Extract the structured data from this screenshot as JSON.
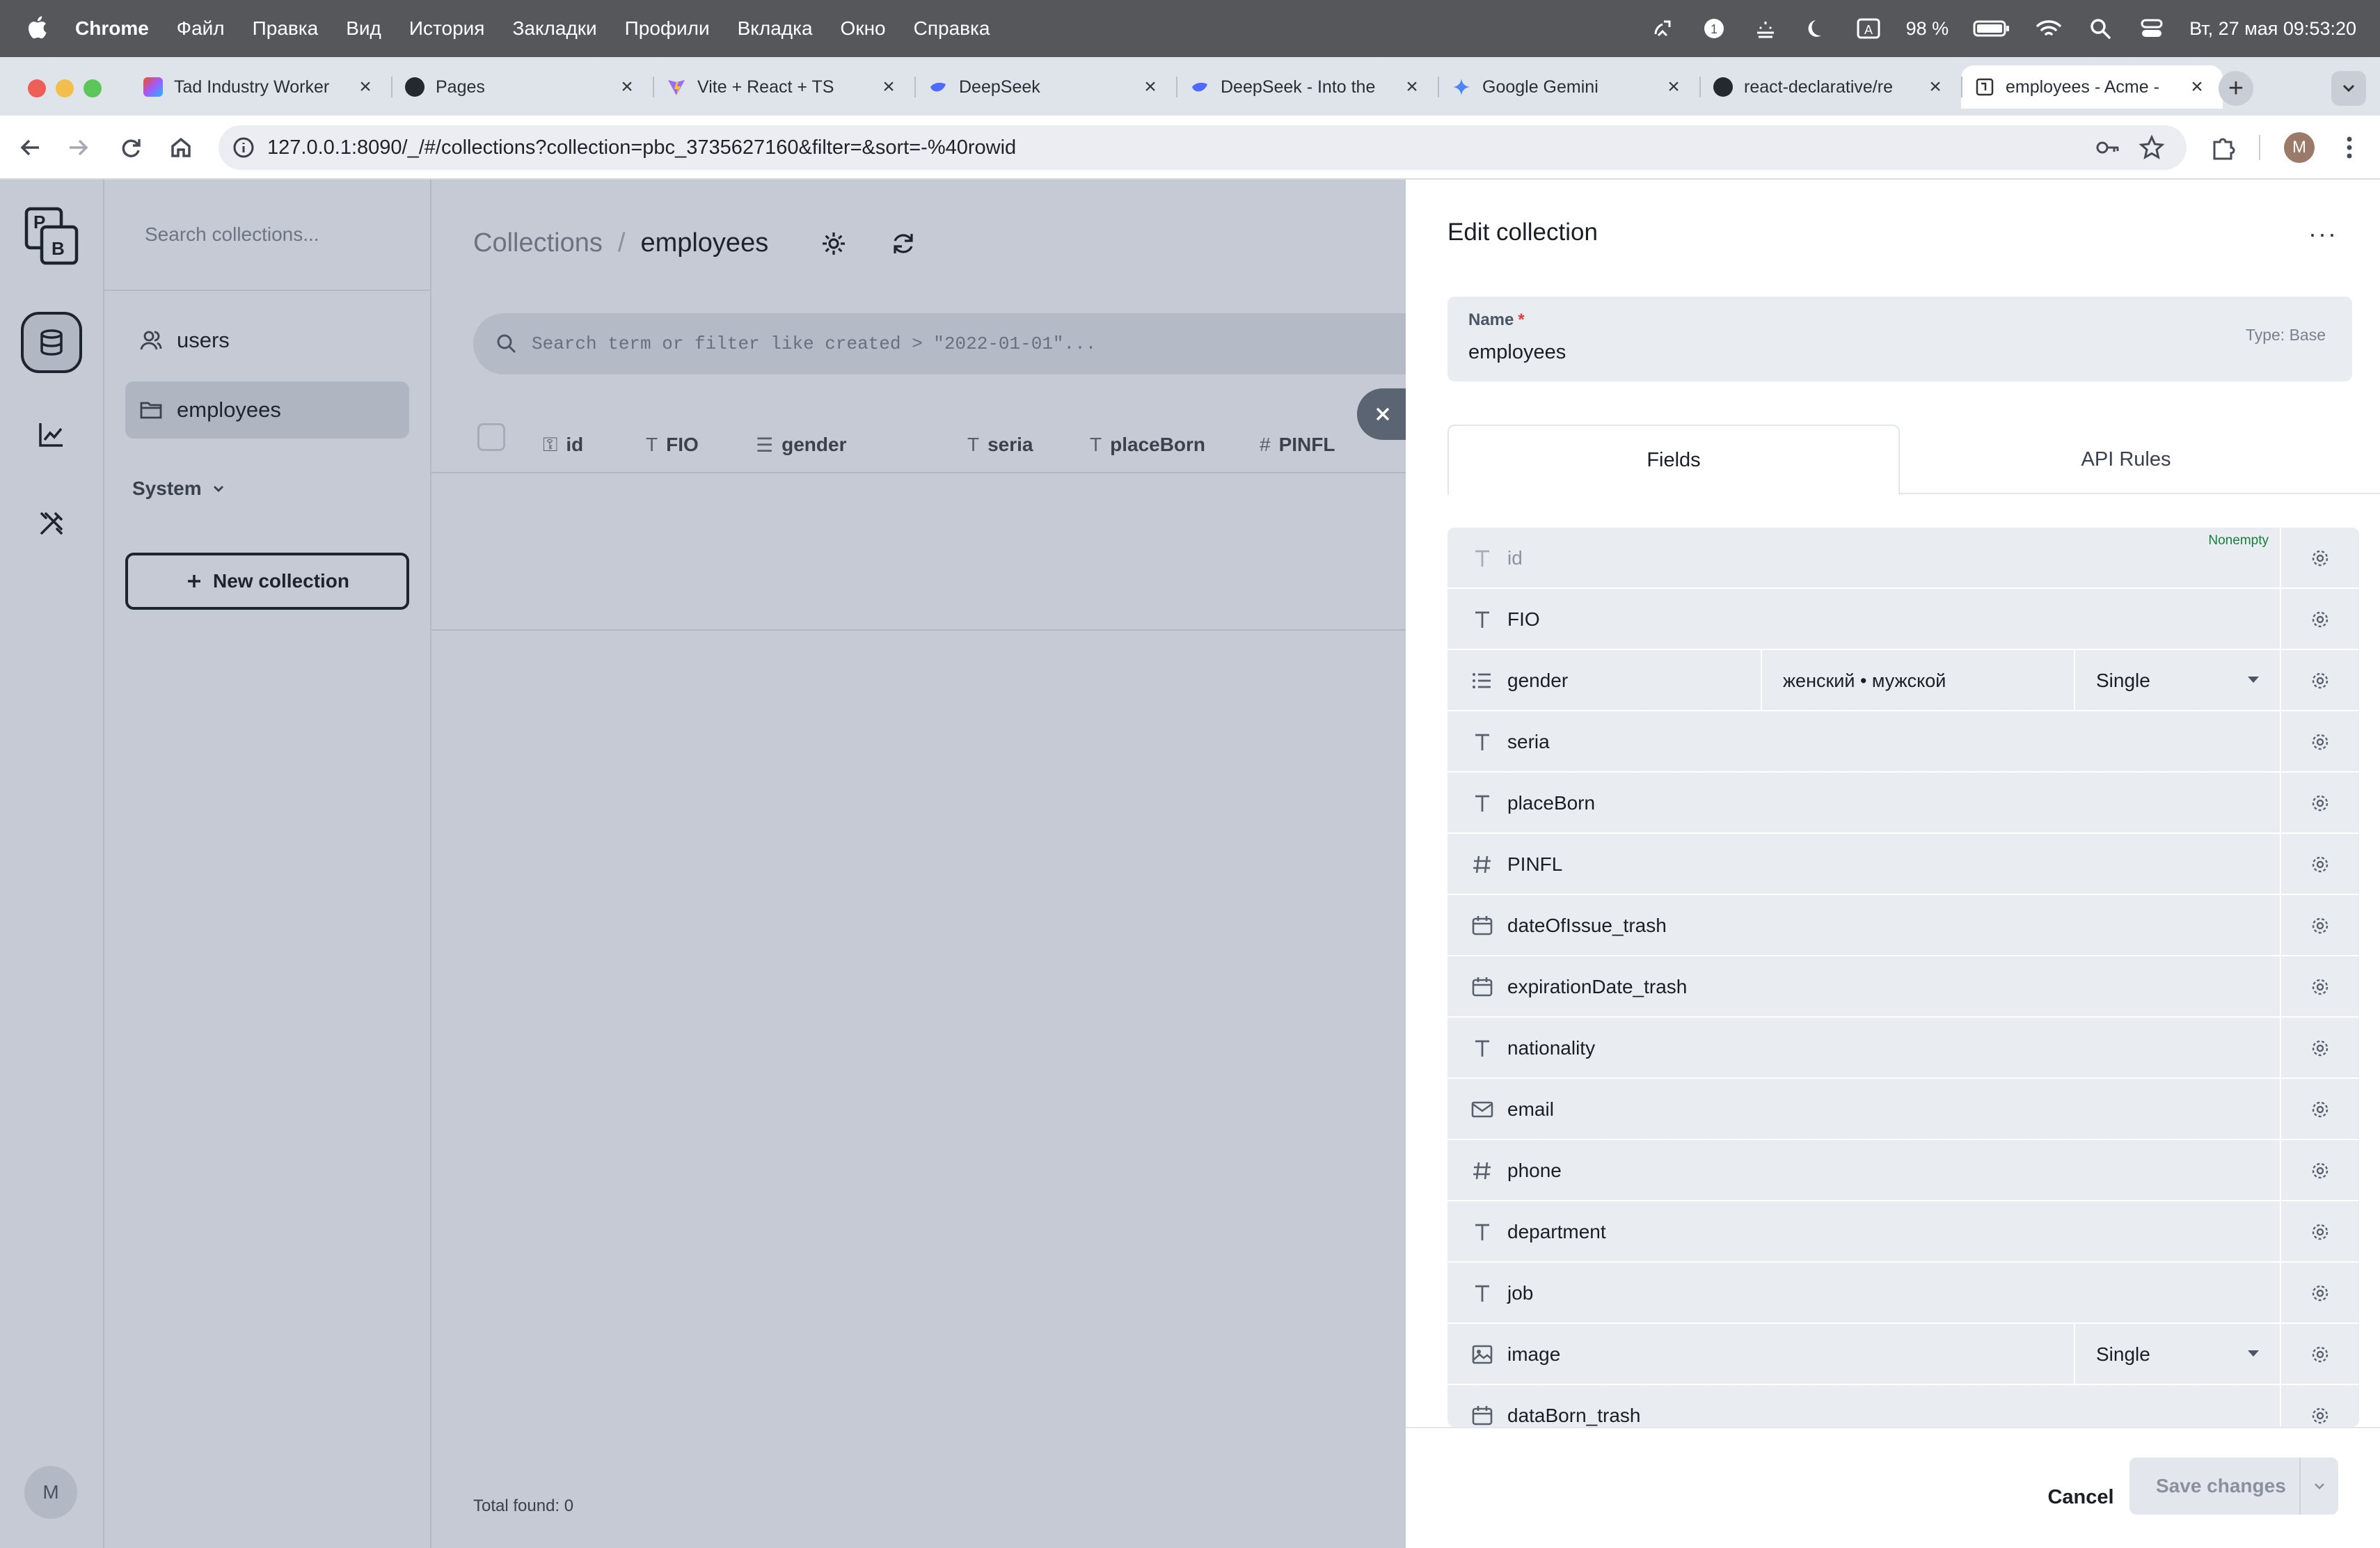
{
  "menubar": {
    "app": "Chrome",
    "items": [
      "Файл",
      "Правка",
      "Вид",
      "История",
      "Закладки",
      "Профили",
      "Вкладка",
      "Окно",
      "Справка"
    ],
    "battery": "98 %",
    "input_indicator": "A",
    "clock": "Вт, 27 мая  09:53:20"
  },
  "browser": {
    "tabs": [
      {
        "title": "Tad Industry Worker",
        "favicon": "figma-icon",
        "active": false
      },
      {
        "title": "Pages",
        "favicon": "github-icon",
        "active": false
      },
      {
        "title": "Vite + React + TS",
        "favicon": "vite-icon",
        "active": false
      },
      {
        "title": "DeepSeek",
        "favicon": "deepseek-icon",
        "active": false
      },
      {
        "title": "DeepSeek - Into the",
        "favicon": "deepseek-icon",
        "active": false
      },
      {
        "title": "Google Gemini",
        "favicon": "gemini-icon",
        "active": false
      },
      {
        "title": "react-declarative/re",
        "favicon": "github-icon",
        "active": false
      },
      {
        "title": "employees - Acme -",
        "favicon": "pocketbase-icon",
        "active": true
      }
    ],
    "url": "127.0.0.1:8090/_/#/collections?collection=pbc_3735627160&filter=&sort=-%40rowid",
    "profile_initial": "M"
  },
  "sidebar": {
    "search_placeholder": "Search collections...",
    "collections": [
      {
        "label": "users",
        "icon": "users-icon",
        "active": false
      },
      {
        "label": "employees",
        "icon": "folder-icon",
        "active": true
      }
    ],
    "system_label": "System",
    "new_collection_label": "New collection",
    "user_initial": "M"
  },
  "main": {
    "breadcrumb_root": "Collections",
    "breadcrumb_sep": "/",
    "breadcrumb_current": "employees",
    "filter_placeholder": "Search term or filter like created > \"2022-01-01\"...",
    "columns": [
      {
        "label": "id",
        "icon": "key-icon"
      },
      {
        "label": "FIO",
        "icon": "text-icon"
      },
      {
        "label": "gender",
        "icon": "list-icon"
      },
      {
        "label": "seria",
        "icon": "text-icon"
      },
      {
        "label": "placeBorn",
        "icon": "text-icon"
      },
      {
        "label": "PINFL",
        "icon": "hash-icon"
      }
    ],
    "total_found": "Total found:  0"
  },
  "panel": {
    "title": "Edit collection",
    "name_label": "Name",
    "name_required_mark": "*",
    "name_value": "employees",
    "type_label": "Type: Base",
    "tabs": [
      "Fields",
      "API Rules"
    ],
    "fields": [
      {
        "name": "id",
        "icon": "text-icon",
        "muted": true,
        "badge": "Nonempty"
      },
      {
        "name": "FIO",
        "icon": "text-icon"
      },
      {
        "name": "gender",
        "icon": "list-icon",
        "options": "женский • мужской",
        "select": "Single"
      },
      {
        "name": "seria",
        "icon": "text-icon"
      },
      {
        "name": "placeBorn",
        "icon": "text-icon"
      },
      {
        "name": "PINFL",
        "icon": "hash-icon"
      },
      {
        "name": "dateOfIssue_trash",
        "icon": "calendar-icon"
      },
      {
        "name": "expirationDate_trash",
        "icon": "calendar-icon"
      },
      {
        "name": "nationality",
        "icon": "text-icon"
      },
      {
        "name": "email",
        "icon": "mail-icon"
      },
      {
        "name": "phone",
        "icon": "hash-icon"
      },
      {
        "name": "department",
        "icon": "text-icon"
      },
      {
        "name": "job",
        "icon": "text-icon"
      },
      {
        "name": "image",
        "icon": "image-icon",
        "select": "Single"
      },
      {
        "name": "dataBorn_trash",
        "icon": "calendar-icon"
      }
    ],
    "cancel_label": "Cancel",
    "save_label": "Save changes"
  }
}
